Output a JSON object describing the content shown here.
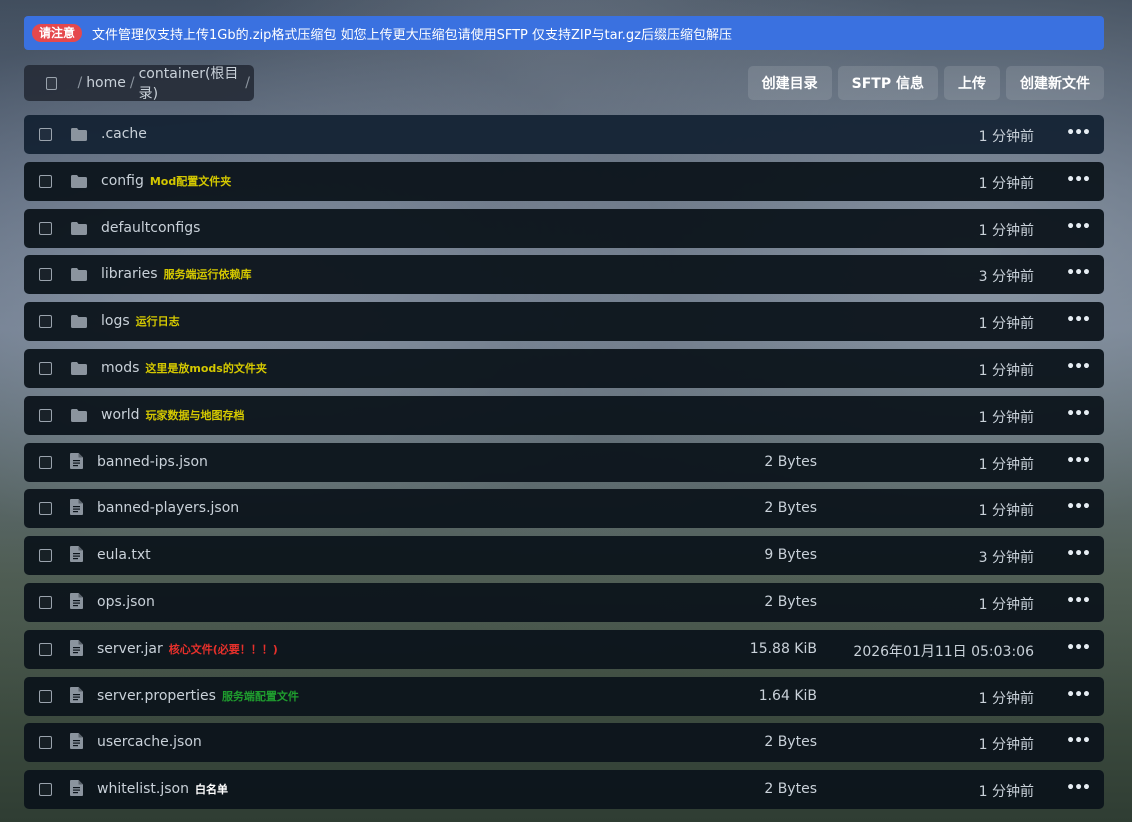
{
  "banner": {
    "badge": "请注意",
    "text": "文件管理仅支持上传1Gb的.zip格式压缩包 如您上传更大压缩包请使用SFTP 仅支持ZIP与tar.gz后缀压缩包解压"
  },
  "breadcrumb": {
    "separator": "/",
    "segments": [
      "home",
      "container(根目录)"
    ]
  },
  "actions": {
    "create_dir": "创建目录",
    "sftp": "SFTP 信息",
    "upload": "上传",
    "create_file": "创建新文件"
  },
  "colors": {
    "banner_bg": "#3a71e0",
    "badge_bg": "#e5484d",
    "note_yellow": "#d4c800",
    "note_red": "#e5302b",
    "note_green": "#1f9d2e",
    "note_white": "#ffffff",
    "row_bg": "#0c141b"
  },
  "more_icon_text": "•••",
  "files": [
    {
      "type": "folder",
      "name": ".cache",
      "note": "",
      "note_color": "",
      "size": "",
      "time": "1 分钟前"
    },
    {
      "type": "folder",
      "name": "config",
      "note": "Mod配置文件夹",
      "note_color": "#d4c800",
      "size": "",
      "time": "1 分钟前"
    },
    {
      "type": "folder",
      "name": "defaultconfigs",
      "note": "",
      "note_color": "",
      "size": "",
      "time": "1 分钟前"
    },
    {
      "type": "folder",
      "name": "libraries",
      "note": "服务端运行依赖库",
      "note_color": "#d4c800",
      "size": "",
      "time": "3 分钟前"
    },
    {
      "type": "folder",
      "name": "logs",
      "note": "运行日志",
      "note_color": "#d4c800",
      "size": "",
      "time": "1 分钟前"
    },
    {
      "type": "folder",
      "name": "mods",
      "note": "这里是放mods的文件夹",
      "note_color": "#d4c800",
      "size": "",
      "time": "1 分钟前"
    },
    {
      "type": "folder",
      "name": "world",
      "note": "玩家数据与地图存档",
      "note_color": "#d4c800",
      "size": "",
      "time": "1 分钟前"
    },
    {
      "type": "file",
      "name": "banned-ips.json",
      "note": "",
      "note_color": "",
      "size": "2 Bytes",
      "time": "1 分钟前"
    },
    {
      "type": "file",
      "name": "banned-players.json",
      "note": "",
      "note_color": "",
      "size": "2 Bytes",
      "time": "1 分钟前"
    },
    {
      "type": "file",
      "name": "eula.txt",
      "note": "",
      "note_color": "",
      "size": "9 Bytes",
      "time": "3 分钟前"
    },
    {
      "type": "file",
      "name": "ops.json",
      "note": "",
      "note_color": "",
      "size": "2 Bytes",
      "time": "1 分钟前"
    },
    {
      "type": "file",
      "name": "server.jar",
      "note": "核心文件(必要！！！)",
      "note_color": "#e5302b",
      "size": "15.88 KiB",
      "time": "2026年01月11日 05:03:06"
    },
    {
      "type": "file",
      "name": "server.properties",
      "note": "服务端配置文件",
      "note_color": "#1f9d2e",
      "size": "1.64 KiB",
      "time": "1 分钟前"
    },
    {
      "type": "file",
      "name": "usercache.json",
      "note": "",
      "note_color": "",
      "size": "2 Bytes",
      "time": "1 分钟前"
    },
    {
      "type": "file",
      "name": "whitelist.json",
      "note": "白名单",
      "note_color": "#ffffff",
      "size": "2 Bytes",
      "time": "1 分钟前"
    }
  ]
}
